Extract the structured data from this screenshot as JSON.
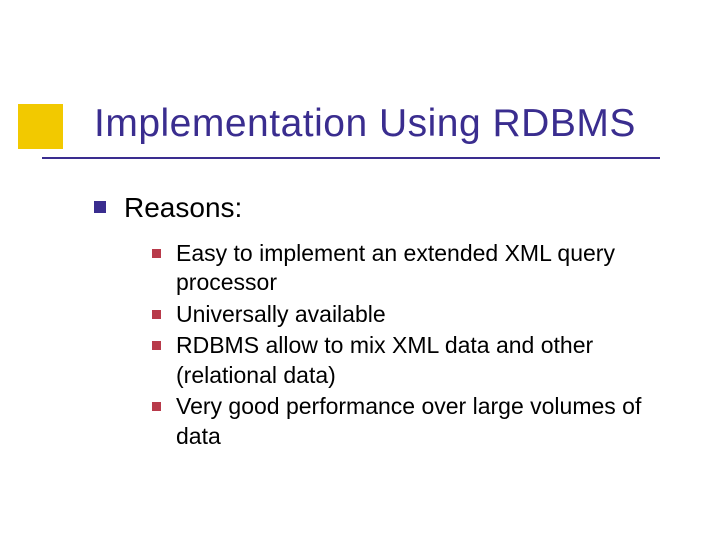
{
  "title": "Implementation Using RDBMS",
  "bullets": {
    "lvl1": "Reasons:",
    "lvl2": [
      "Easy to implement an extended XML query processor",
      "Universally available",
      "RDBMS allow to mix XML data and other (relational data)",
      "Very good performance over large volumes of data"
    ]
  },
  "colors": {
    "title": "#3a2d8f",
    "accent_block": "#f2c900",
    "lvl1_bullet": "#3a2d8f",
    "lvl2_bullet": "#b83a4a"
  }
}
